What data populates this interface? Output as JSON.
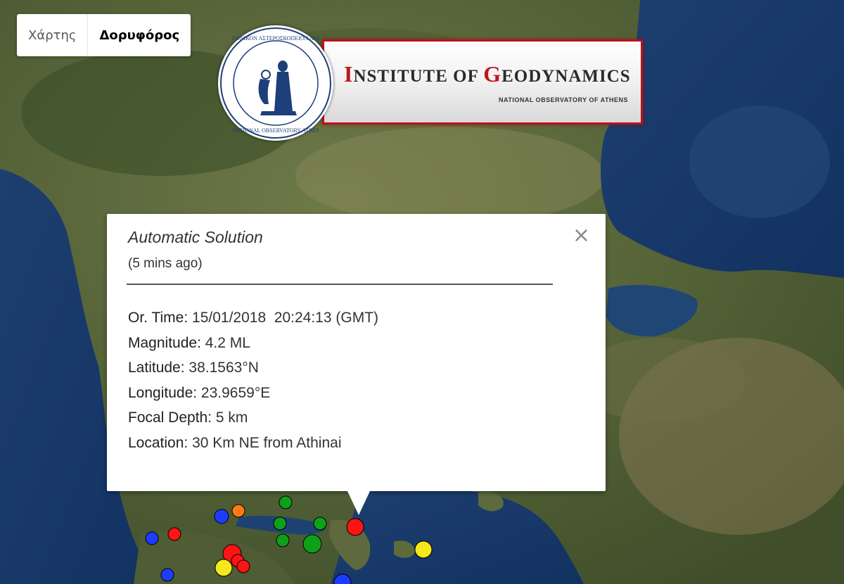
{
  "map_type_control": {
    "map_label": "Χάρτης",
    "satellite_label": "Δορυφόρος",
    "selected": "Δορυφόρος"
  },
  "logo": {
    "title_first_letter": "I",
    "title_rest_1": "NSTITUTE OF ",
    "title_letter_2": "G",
    "title_rest_2": "EODYNAMICS",
    "subtitle": "NATIONAL OBSERVATORY OF ATHENS",
    "seal_top_text": "ΕΘΝΙΚΟΝ ΑΣΤΕΡΟΣΚΟΠΕΙΟΝ ΑΘΗΝΩΝ",
    "seal_bottom_text": "NATIONAL OBSERVATORY ATHENS",
    "accent_color": "#b8121e"
  },
  "info_window": {
    "title": "Automatic Solution",
    "subtitle": "(5 mins ago)",
    "close_glyph": "×",
    "fields": [
      {
        "label": "Or. Time:",
        "value": " 15/01/2018  20:24:13 (GMT)"
      },
      {
        "label": "Magnitude:",
        "value": " 4.2 ML"
      },
      {
        "label": "Latitude:",
        "value": " 38.1563°N"
      },
      {
        "label": "Longitude:",
        "value": " 23.9659°E"
      },
      {
        "label": "Focal Depth:",
        "value": " 5 km"
      },
      {
        "label": "Location:",
        "value": " 30 Km NE from Athinai"
      }
    ]
  },
  "markers": [
    {
      "color": "red",
      "selected": true
    },
    {
      "color": "yellow"
    },
    {
      "color": "green"
    },
    {
      "color": "green"
    },
    {
      "color": "green"
    },
    {
      "color": "green"
    },
    {
      "color": "green"
    },
    {
      "color": "orange"
    },
    {
      "color": "blue"
    },
    {
      "color": "blue"
    },
    {
      "color": "blue"
    },
    {
      "color": "blue"
    },
    {
      "color": "red"
    },
    {
      "color": "red"
    },
    {
      "color": "red"
    },
    {
      "color": "red"
    },
    {
      "color": "yellow"
    }
  ],
  "marker_colors": {
    "red": "#ff1414",
    "yellow": "#f5e81c",
    "green": "#0fa019",
    "orange": "#ff7a12",
    "blue": "#1e3cff"
  }
}
